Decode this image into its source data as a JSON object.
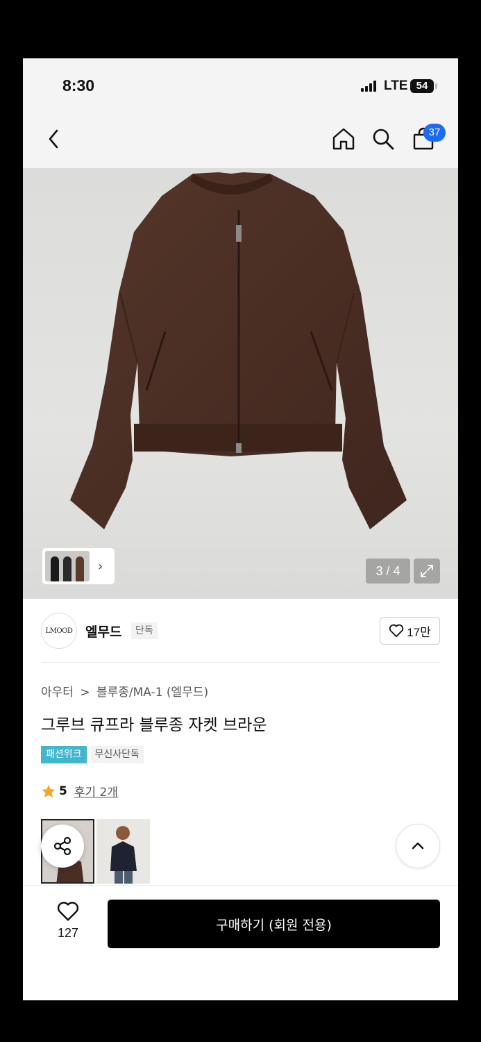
{
  "status_bar": {
    "time": "8:30",
    "network": "LTE",
    "battery": "54"
  },
  "nav": {
    "back_icon": "chevron-left-icon",
    "home_icon": "home-icon",
    "search_icon": "search-icon",
    "cart_icon": "shopping-bag-icon",
    "cart_badge": "37"
  },
  "gallery": {
    "counter": "3 / 4",
    "expand_icon": "expand-icon"
  },
  "brand": {
    "logo_text": "LMOOD",
    "name": "엘무드",
    "tag": "단독",
    "likes": "17만"
  },
  "product": {
    "breadcrumb_category": "아우터",
    "breadcrumb_separator": ">",
    "breadcrumb_sub": "블루종/MA-1 (엘무드)",
    "title": "그루브 큐프라 블루종 자켓 브라운",
    "tags": [
      "패션위크",
      "무신사단독"
    ],
    "rating": "5",
    "reviews_link": "후기 2개"
  },
  "bottom": {
    "wishlist_count": "127",
    "buy_label": "구매하기 (회원 전용)"
  },
  "colors": {
    "accent_badge": "#1b6cf2",
    "tag_blue": "#43b6cf",
    "rating_star": "#f5a623",
    "jacket": "#4a2e24"
  }
}
